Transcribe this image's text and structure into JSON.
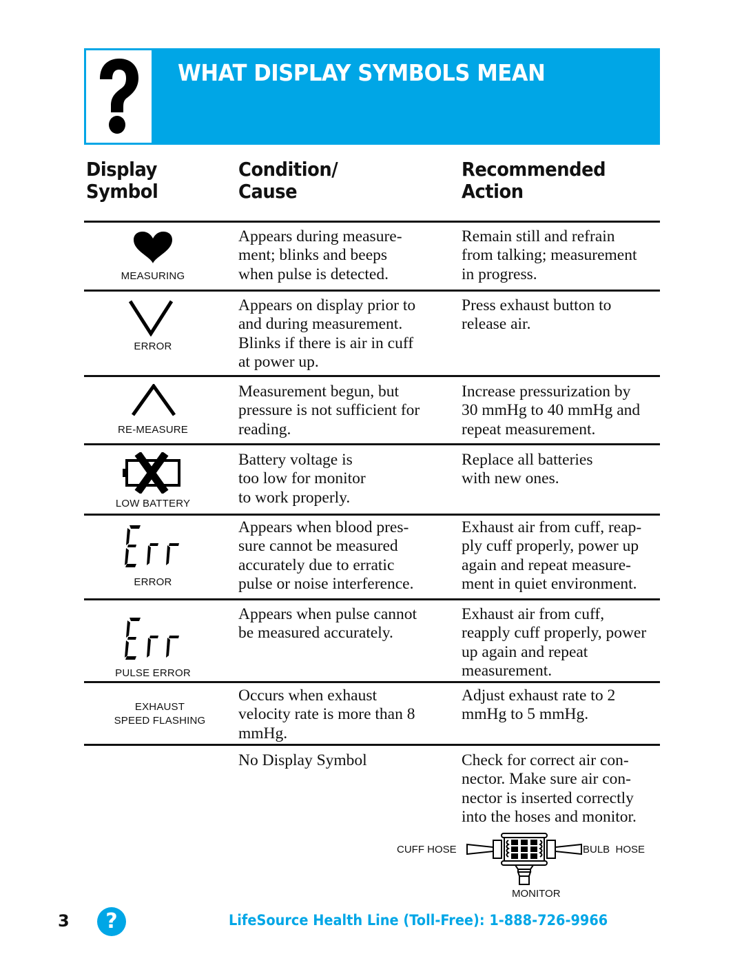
{
  "banner": {
    "title": "WHAT DISPLAY SYMBOLS MEAN",
    "icon": "question-mark-icon",
    "color": "#00a6e6"
  },
  "headers": {
    "symbol": [
      "Display",
      "Symbol"
    ],
    "condition": [
      "Condition/",
      "Cause"
    ],
    "action": [
      "Recommended",
      "Action"
    ]
  },
  "rows": [
    {
      "icon": "heart-icon",
      "label": "MEASURING",
      "condition": "Appears during measure-\nment; blinks and beeps\nwhen pulse is detected.",
      "action": "Remain still and refrain\nfrom talking; measurement\nin progress."
    },
    {
      "icon": "down-chevron-icon",
      "label": "ERROR",
      "condition": "Appears on display prior to\nand during measurement.\nBlinks if there is air in cuff\nat power up.",
      "action": "Press exhaust button to\nrelease air."
    },
    {
      "icon": "up-chevron-icon",
      "label": "RE-MEASURE",
      "condition": "Measurement begun, but\npressure is not sufficient for\nreading.",
      "action": "Increase pressurization by\n30 mmHg to 40 mmHg and\nrepeat measurement."
    },
    {
      "icon": "low-battery-icon",
      "label": "LOW BATTERY",
      "condition": "Battery voltage is\ntoo low for monitor\nto work properly.",
      "action": "Replace all batteries\nwith new ones."
    },
    {
      "icon": "err-display-icon",
      "label": "ERROR",
      "condition": "Appears when blood pres-\nsure cannot be measured\naccurately due to erratic\npulse or noise interference.",
      "action": "Exhaust air from cuff, reap-\nply cuff properly, power up\nagain and repeat measure-\nment in quiet environment."
    },
    {
      "icon": "err-display-icon",
      "label": "PULSE ERROR",
      "condition": "Appears when pulse cannot\nbe measured accurately.",
      "action": "Exhaust air from cuff,\nreapply cuff properly, power\nup again and repeat\nmeasurement."
    },
    {
      "icon": "",
      "label": "EXHAUST\nSPEED FLASHING",
      "condition": "Occurs when exhaust\nvelocity rate is more than 8\nmmHg.",
      "action": "Adjust exhaust rate to 2\nmmHg to 5 mmHg."
    },
    {
      "icon": "",
      "label": "",
      "condition": "No Display Symbol",
      "action": "Check for correct air con-\nnector. Make sure air con-\nnector is inserted correctly\ninto the hoses and monitor."
    }
  ],
  "connector_diagram": {
    "icon": "air-connector-icon",
    "left_label": "CUFF HOSE",
    "right_label": "BULB  HOSE",
    "bottom_label": "MONITOR"
  },
  "footer": {
    "page_number": "3",
    "icon_glyph": "?",
    "health_line": "LifeSource Health Line (Toll-Free): 1-888-726-9966"
  }
}
